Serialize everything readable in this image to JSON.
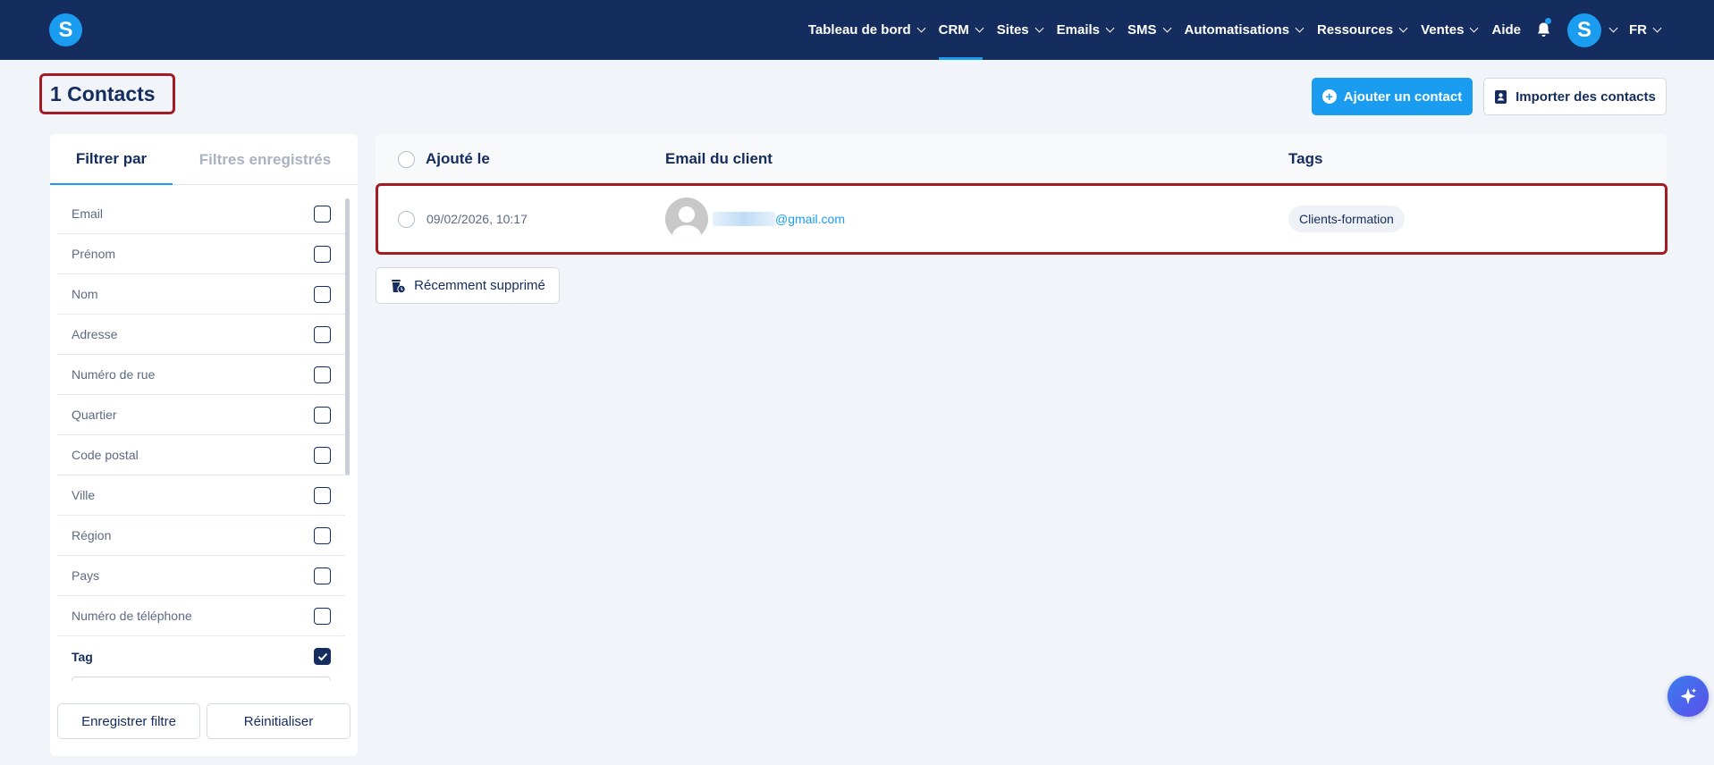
{
  "brand": {
    "logo_letter": "S"
  },
  "nav": {
    "items": [
      {
        "label": "Tableau de bord",
        "dropdown": true,
        "active": false
      },
      {
        "label": "CRM",
        "dropdown": true,
        "active": true
      },
      {
        "label": "Sites",
        "dropdown": true,
        "active": false
      },
      {
        "label": "Emails",
        "dropdown": true,
        "active": false
      },
      {
        "label": "SMS",
        "dropdown": true,
        "active": false
      },
      {
        "label": "Automatisations",
        "dropdown": true,
        "active": false
      },
      {
        "label": "Ressources",
        "dropdown": true,
        "active": false
      },
      {
        "label": "Ventes",
        "dropdown": true,
        "active": false
      },
      {
        "label": "Aide",
        "dropdown": false,
        "active": false
      }
    ],
    "avatar_letter": "S",
    "language": "FR"
  },
  "header": {
    "title": "1 Contacts",
    "add_button": "Ajouter un contact",
    "import_button": "Importer des contacts"
  },
  "filters": {
    "tab_active": "Filtrer par",
    "tab_saved": "Filtres enregistrés",
    "fields": [
      {
        "label": "Email",
        "checked": false
      },
      {
        "label": "Prénom",
        "checked": false
      },
      {
        "label": "Nom",
        "checked": false
      },
      {
        "label": "Adresse",
        "checked": false
      },
      {
        "label": "Numéro de rue",
        "checked": false
      },
      {
        "label": "Quartier",
        "checked": false
      },
      {
        "label": "Code postal",
        "checked": false
      },
      {
        "label": "Ville",
        "checked": false
      },
      {
        "label": "Région",
        "checked": false
      },
      {
        "label": "Pays",
        "checked": false
      },
      {
        "label": "Numéro de téléphone",
        "checked": false
      },
      {
        "label": "Tag",
        "checked": true
      }
    ],
    "save_button": "Enregistrer filtre",
    "reset_button": "Réinitialiser"
  },
  "table": {
    "columns": {
      "added": "Ajouté le",
      "email": "Email du client",
      "tags": "Tags"
    },
    "rows": [
      {
        "added": "09/02/2026, 10:17",
        "email": "@gmail.com",
        "tag": "Clients-formation"
      }
    ],
    "recently_deleted": "Récemment supprimé"
  },
  "colors": {
    "navy": "#142c5e",
    "accent": "#1a9cf0",
    "highlight": "#a31c24"
  }
}
